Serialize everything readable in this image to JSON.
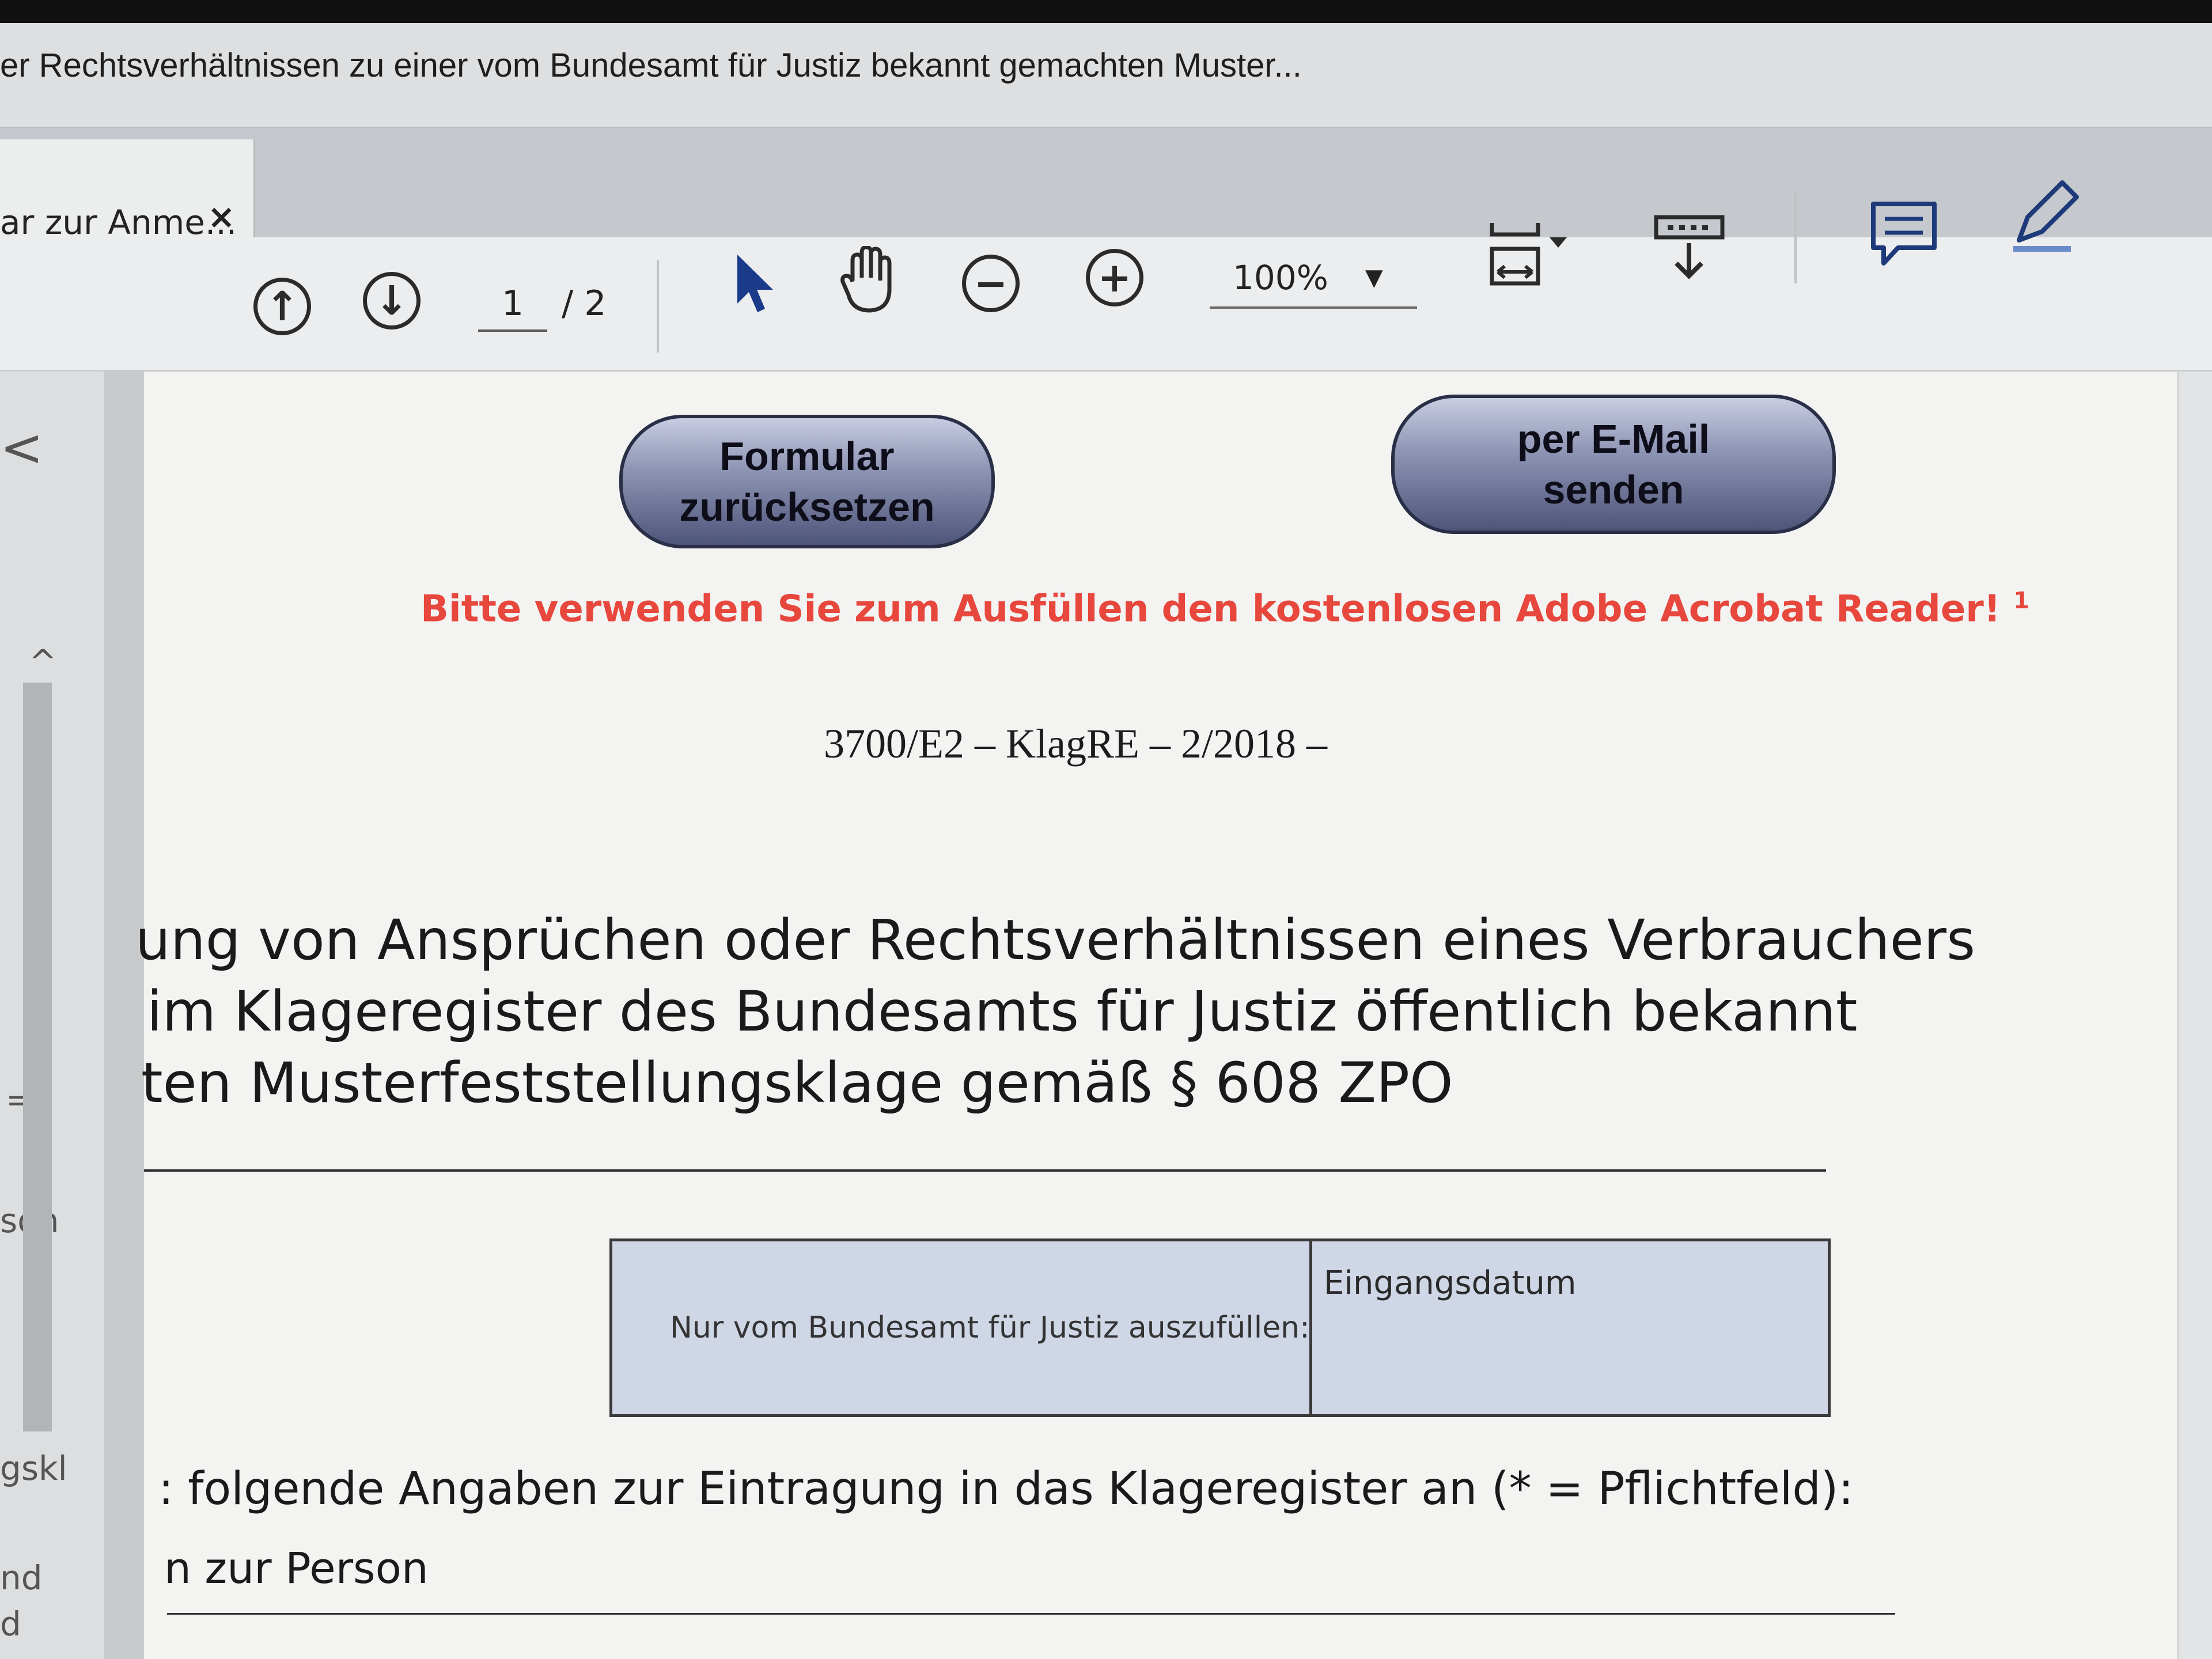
{
  "window": {
    "title": "er Rechtsverhältnissen zu einer vom Bundesamt für Justiz bekannt gemachten Muster..."
  },
  "tab": {
    "label": "ar zur Anme...",
    "close": "×"
  },
  "toolbar": {
    "page_current": "1",
    "page_total": "/ 2",
    "zoom": "100%",
    "zoom_arrow": "▼"
  },
  "leftpane": {
    "chevron": "<",
    "up": "^",
    "eq": "=",
    "frag1": "son",
    "frag2": "gskl",
    "frag3": "nd",
    "frag4": "d"
  },
  "form": {
    "reset_line1": "Formular",
    "reset_line2": "zurücksetzen",
    "email_line1": "per E-Mail",
    "email_line2": "senden",
    "notice": "Bitte verwenden Sie zum Ausfüllen den kostenlosen Adobe Acrobat Reader!",
    "notice_sup": "1",
    "reference": "3700/E2 – KlagRE – 2/2018 –",
    "heading_line1": "ung von Ansprüchen oder Rechtsverhältnissen eines Verbrauchers",
    "heading_line2": "im Klageregister des Bundesamts für Justiz öffentlich bekannt",
    "heading_line3": "ten Musterfeststellungsklage gemäß § 608 ZPO",
    "office_label": "Nur vom Bundesamt für Justiz auszufüllen:",
    "office_date_label": "Eingangsdatum",
    "instruction": ": folgende Angaben zur Eintragung in das Klageregister an (* = Pflichtfeld):",
    "section": "n zur Person"
  },
  "colors": {
    "notice": "#e7473c",
    "button_dark": "#2a2f48"
  }
}
